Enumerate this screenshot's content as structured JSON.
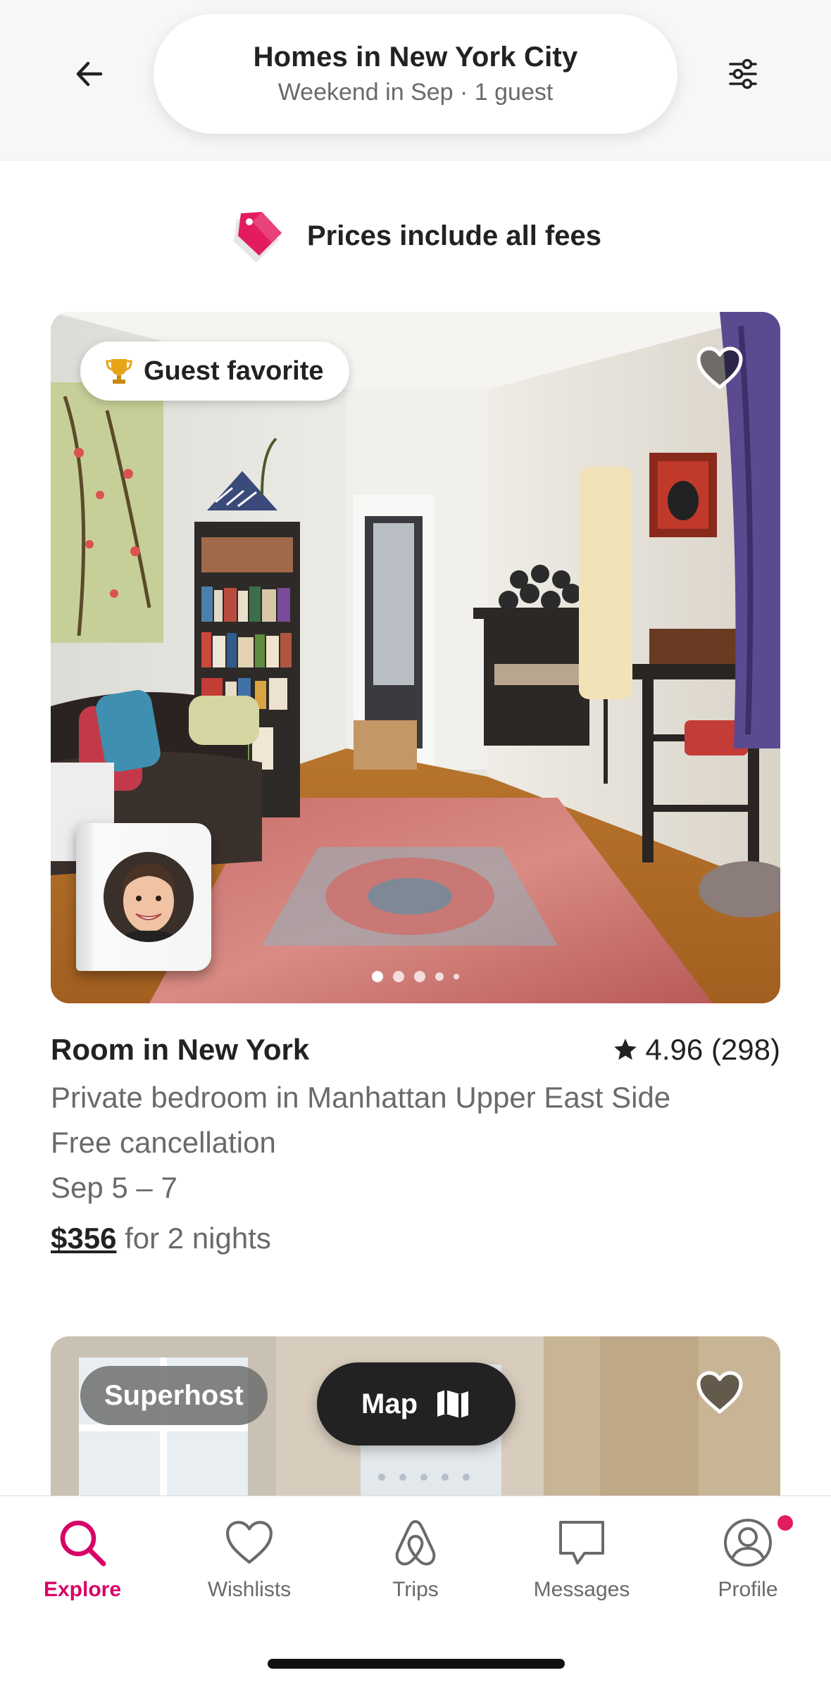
{
  "header": {
    "title": "Homes in New York City",
    "subtitle": "Weekend in Sep · 1 guest",
    "back_icon": "arrow-left-icon",
    "filter_icon": "sliders-icon"
  },
  "fees_banner": {
    "text": "Prices include all fees",
    "icon": "price-tag-icon",
    "icon_color": "#e31c5f"
  },
  "listing": {
    "badge": "Guest favorite",
    "badge_icon": "trophy-icon",
    "title": "Room in New York",
    "rating": "4.96 (298)",
    "description": "Private bedroom in Manhattan Upper East Side",
    "cancellation": "Free cancellation",
    "dates": "Sep 5 – 7",
    "price": "$356",
    "price_suffix": " for 2 nights",
    "photo_count": 5,
    "active_photo": 0
  },
  "listing2": {
    "badge": "Superhost"
  },
  "map_button": {
    "label": "Map",
    "icon": "map-icon"
  },
  "nav": {
    "active_color": "#d70466",
    "items": [
      {
        "label": "Explore",
        "icon": "search-icon"
      },
      {
        "label": "Wishlists",
        "icon": "heart-icon"
      },
      {
        "label": "Trips",
        "icon": "airbnb-logo-icon"
      },
      {
        "label": "Messages",
        "icon": "message-icon"
      },
      {
        "label": "Profile",
        "icon": "profile-icon"
      }
    ]
  }
}
